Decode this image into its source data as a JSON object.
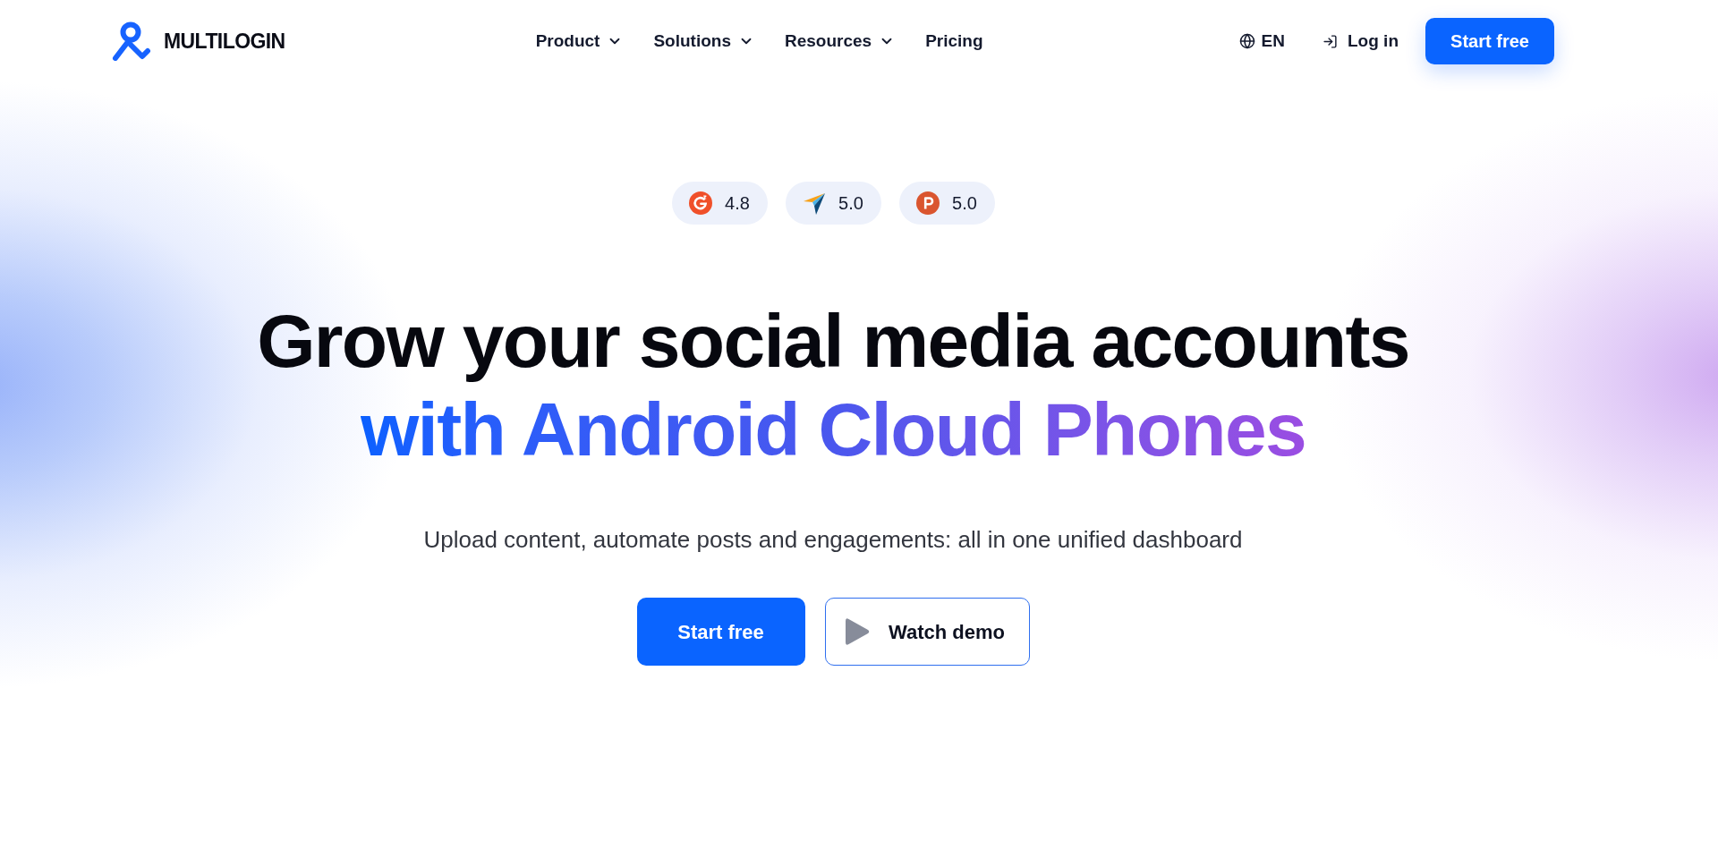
{
  "header": {
    "logo": {
      "wordmark": "MULTILOGIN"
    },
    "nav": [
      {
        "kind": "menu",
        "label": "Product"
      },
      {
        "kind": "menu",
        "label": "Solutions"
      },
      {
        "kind": "menu",
        "label": "Resources"
      },
      {
        "kind": "link",
        "label": "Pricing"
      }
    ],
    "language": "EN",
    "login": "Log in",
    "cta": "Start free"
  },
  "hero": {
    "ratings": [
      {
        "kind": "g2",
        "score": "4.8"
      },
      {
        "kind": "arrow",
        "score": "5.0"
      },
      {
        "kind": "p",
        "score": "5.0"
      }
    ],
    "title": "Grow your social media accounts",
    "title_highlight": "with Android Cloud Phones",
    "subtitle": "Upload content, automate posts and engagements: all in one unified dashboard",
    "actions": [
      {
        "kind": "primary",
        "label": "Start free"
      },
      {
        "kind": "video",
        "label": "Watch demo"
      }
    ]
  }
}
